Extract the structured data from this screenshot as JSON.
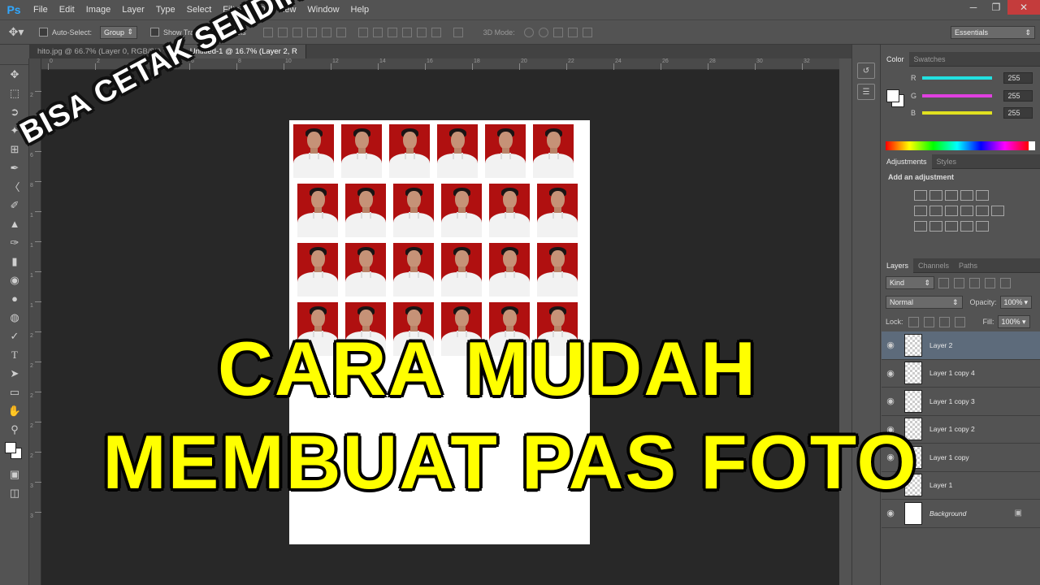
{
  "app": {
    "logo": "Ps",
    "menu": [
      "File",
      "Edit",
      "Image",
      "Layer",
      "Type",
      "Select",
      "Filter",
      "3D",
      "View",
      "Window",
      "Help"
    ],
    "window_controls": [
      "minimize-icon",
      "restore-icon",
      "close-icon"
    ]
  },
  "options": {
    "tool_icon": "move-icon",
    "auto_select_label": "Auto-Select:",
    "auto_select_value": "Group",
    "show_transform_label": "Show Transform Controls",
    "mode_3d_label": "3D Mode:",
    "workspace": "Essentials"
  },
  "tabs": [
    {
      "label": "hito.jpg @ 66.7% (Layer 0, RGB/8#) *",
      "close": "×",
      "active": false
    },
    {
      "label": "Untitled-1 @ 16.7% (Layer 2, R",
      "close": "",
      "active": true
    }
  ],
  "toolbar": {
    "tools": [
      "move-icon",
      "marquee-icon",
      "lasso-icon",
      "magic-wand-icon",
      "crop-icon",
      "eyedropper-icon",
      "healing-icon",
      "brush-icon",
      "stamp-icon",
      "history-brush-icon",
      "eraser-icon",
      "bucket-icon",
      "blur-icon",
      "dodge-icon",
      "pen-icon",
      "type-icon",
      "path-select-icon",
      "rectangle-icon",
      "hand-icon",
      "zoom-icon"
    ],
    "bottom_tools": [
      "quickmask-icon",
      "screen-mode-icon"
    ]
  },
  "ruler": {
    "top_numbers": [
      "0",
      "2",
      "4",
      "6",
      "8",
      "10",
      "12",
      "14",
      "16",
      "18",
      "20",
      "22",
      "24",
      "26",
      "28",
      "30",
      "32"
    ],
    "left_numbers": [
      "2",
      "4",
      "6",
      "8",
      "1",
      "1",
      "1",
      "1",
      "2",
      "2",
      "2",
      "2",
      "2",
      "3",
      "3"
    ]
  },
  "canvas": {
    "background": "#282828",
    "photo_bg": "#b01010",
    "rows": 4,
    "cols": 6
  },
  "overlay": {
    "slant_text": "BISA CETAK SENDIRI",
    "line1": "CARA MUDAH",
    "line2": "MEMBUAT PAS FOTO",
    "title_color": "#ffff00"
  },
  "color_panel": {
    "tabs": [
      "Color",
      "Swatches"
    ],
    "channels": [
      {
        "label": "R",
        "value": "255",
        "color": "#22e0e0"
      },
      {
        "label": "G",
        "value": "255",
        "color": "#e040e0"
      },
      {
        "label": "B",
        "value": "255",
        "color": "#e0e020"
      }
    ]
  },
  "adjustments": {
    "tabs": [
      "Adjustments",
      "Styles"
    ],
    "title": "Add an adjustment"
  },
  "layers_panel": {
    "tabs": [
      "Layers",
      "Channels",
      "Paths"
    ],
    "filter": "Kind",
    "blend_mode": "Normal",
    "opacity_label": "Opacity:",
    "opacity": "100%",
    "lock_label": "Lock:",
    "fill_label": "Fill:",
    "fill": "100%",
    "layers": [
      {
        "name": "Layer 2",
        "active": true,
        "thumb": "transparent"
      },
      {
        "name": "Layer 1 copy 4",
        "active": false,
        "thumb": "transparent"
      },
      {
        "name": "Layer 1 copy 3",
        "active": false,
        "thumb": "transparent"
      },
      {
        "name": "Layer 1 copy 2",
        "active": false,
        "thumb": "transparent"
      },
      {
        "name": "Layer 1 copy",
        "active": false,
        "thumb": "transparent"
      },
      {
        "name": "Layer 1",
        "active": false,
        "thumb": "transparent"
      },
      {
        "name": "Background",
        "active": false,
        "thumb": "white"
      }
    ]
  }
}
